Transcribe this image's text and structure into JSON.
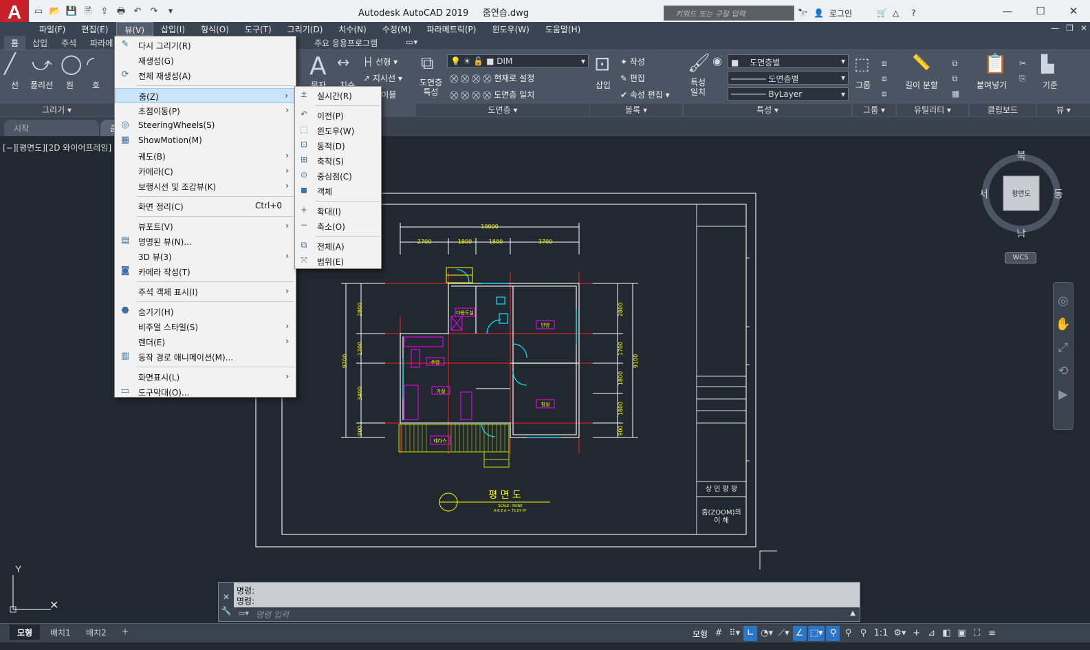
{
  "app": {
    "logo": "A",
    "title": "Autodesk AutoCAD 2019",
    "filename": "줌연습.dwg",
    "search_placeholder": "키워드 또는 구절 입력",
    "login": "로그인"
  },
  "menubar": [
    "파일(F)",
    "편집(E)",
    "뷰(V)",
    "삽입(I)",
    "형식(O)",
    "도구(T)",
    "그리기(D)",
    "치수(N)",
    "수정(M)",
    "파라메트릭(P)",
    "윈도우(W)",
    "도움말(H)"
  ],
  "ribbon_tabs": [
    "홈",
    "삽입",
    "주석",
    "파라메",
    "",
    "",
    "",
    "",
    "주요 응용프로그램"
  ],
  "ribbon": {
    "draw_tools": [
      "선",
      "폴리선",
      "원",
      "호"
    ],
    "draw_panel": "그리기",
    "text": "문자",
    "dim": "치수",
    "linear": "선형",
    "leader": "지시선",
    "table": "테이블",
    "layer_props": "도면층\n특성",
    "layer_current": "DIM",
    "make_current": "현재로 설정",
    "match_layer": "도면층 일치",
    "layer_panel": "도면층",
    "insert": "삽입",
    "create": "작성",
    "edit": "편집",
    "edit_attr": "속성 편집",
    "block_panel": "블록",
    "match_props": "특성\n일치",
    "color_bylayer": "도면층별",
    "linetype_bylayer": "도면층별",
    "lineweight_bylayer": "ByLayer",
    "props_panel": "특성",
    "group": "그룹",
    "group_panel": "그룹",
    "measure": "길이 분할",
    "util_panel": "유틸리티",
    "paste": "붙여넣기",
    "clip_panel": "클립보드",
    "base": "기준",
    "view_panel": "뷰"
  },
  "file_tabs": [
    "시작",
    "줌"
  ],
  "viewport_label": "[−][평면도][2D 와이어프레임]",
  "viewcube": {
    "north": "북",
    "south": "남",
    "east": "동",
    "west": "서",
    "face": "평면도",
    "wcs": "WCS"
  },
  "drawing": {
    "title": "평 면 도",
    "scale": "SCALE : NONE",
    "area": "A R E A = 75.07 M²",
    "dim_total": "10000",
    "dims_top": [
      "2700",
      "1800",
      "1800",
      "3700"
    ],
    "dims_left": [
      "2800",
      "1700",
      "3400",
      "900"
    ],
    "dim_left_total": "9700",
    "dims_right": [
      "2800",
      "1700",
      "1800",
      "1800",
      "900"
    ],
    "dim_right_total": "9100",
    "rooms": [
      "다용도실",
      "안방",
      "주방",
      "거실",
      "침실",
      "테라스"
    ],
    "titleblock_1": "상 민 팡 팡",
    "titleblock_2": "줌(ZOOM)의\n이 해"
  },
  "command": {
    "history": [
      "명령:",
      "명령:"
    ],
    "placeholder": "명령 입력"
  },
  "layout_tabs": [
    "모형",
    "배치1",
    "배치2",
    "+"
  ],
  "status": {
    "model": "모형",
    "scale": "1:1"
  },
  "view_menu": {
    "items": [
      {
        "label": "다시 그리기(R)",
        "icon": "pencil-icon",
        "glyph": "✎",
        "submenu": false
      },
      {
        "label": "재생성(G)",
        "icon": "",
        "glyph": "",
        "submenu": false
      },
      {
        "label": "전체 재생성(A)",
        "icon": "regen-all-icon",
        "glyph": "⟳",
        "submenu": false
      },
      {
        "sep": true
      },
      {
        "label": "줌(Z)",
        "icon": "",
        "glyph": "",
        "submenu": true,
        "highlight": true
      },
      {
        "label": "초점이동(P)",
        "icon": "",
        "glyph": "",
        "submenu": true
      },
      {
        "label": "SteeringWheels(S)",
        "icon": "steering-wheel-icon",
        "glyph": "◎",
        "submenu": false
      },
      {
        "label": "ShowMotion(M)",
        "icon": "showmotion-icon",
        "glyph": "▦",
        "submenu": false
      },
      {
        "label": "궤도(B)",
        "icon": "",
        "glyph": "",
        "submenu": true
      },
      {
        "label": "카메라(C)",
        "icon": "",
        "glyph": "",
        "submenu": true
      },
      {
        "label": "보행시선 및 조감뷰(K)",
        "icon": "",
        "glyph": "",
        "submenu": true
      },
      {
        "sep": true
      },
      {
        "label": "화면 정리(C)",
        "icon": "",
        "glyph": "",
        "submenu": false,
        "shortcut": "Ctrl+0"
      },
      {
        "sep": true
      },
      {
        "label": "뷰포트(V)",
        "icon": "",
        "glyph": "",
        "submenu": true
      },
      {
        "label": "명명된 뷰(N)...",
        "icon": "named-view-icon",
        "glyph": "▤",
        "submenu": false
      },
      {
        "label": "3D 뷰(3)",
        "icon": "",
        "glyph": "",
        "submenu": true
      },
      {
        "label": "카메라 작성(T)",
        "icon": "camera-icon",
        "glyph": "◙",
        "submenu": false
      },
      {
        "sep": true
      },
      {
        "label": "주석 객체 표시(I)",
        "icon": "",
        "glyph": "",
        "submenu": true
      },
      {
        "sep": true
      },
      {
        "label": "숨기기(H)",
        "icon": "hide-icon",
        "glyph": "⬣",
        "submenu": false
      },
      {
        "label": "비주얼 스타일(S)",
        "icon": "",
        "glyph": "",
        "submenu": true
      },
      {
        "label": "렌더(E)",
        "icon": "",
        "glyph": "",
        "submenu": true
      },
      {
        "label": "동작 경로 애니메이션(M)...",
        "icon": "motion-path-icon",
        "glyph": "▥",
        "submenu": false
      },
      {
        "sep": true
      },
      {
        "label": "화면표시(L)",
        "icon": "",
        "glyph": "",
        "submenu": true
      },
      {
        "label": "도구막대(O)...",
        "icon": "toolbar-icon",
        "glyph": "▭",
        "submenu": false
      }
    ]
  },
  "zoom_menu": {
    "items": [
      {
        "label": "실시간(R)",
        "icon": "zoom-realtime-icon",
        "glyph": "±"
      },
      {
        "sep": true
      },
      {
        "label": "이전(P)",
        "icon": "zoom-previous-icon",
        "glyph": "↶"
      },
      {
        "label": "윈도우(W)",
        "icon": "zoom-window-icon",
        "glyph": "⬚"
      },
      {
        "label": "동적(D)",
        "icon": "zoom-dynamic-icon",
        "glyph": "⊡"
      },
      {
        "label": "축척(S)",
        "icon": "zoom-scale-icon",
        "glyph": "⊞"
      },
      {
        "label": "중심점(C)",
        "icon": "zoom-center-icon",
        "glyph": "⊙"
      },
      {
        "label": "객체",
        "icon": "zoom-object-icon",
        "glyph": "◼"
      },
      {
        "sep": true
      },
      {
        "label": "확대(I)",
        "icon": "zoom-in-icon",
        "glyph": "+"
      },
      {
        "label": "축소(O)",
        "icon": "zoom-out-icon",
        "glyph": "−"
      },
      {
        "sep": true
      },
      {
        "label": "전체(A)",
        "icon": "zoom-all-icon",
        "glyph": "⧉"
      },
      {
        "label": "범위(E)",
        "icon": "zoom-extents-icon",
        "glyph": "⤧"
      }
    ]
  },
  "colors": {
    "accent": "#2a75c7",
    "canvas": "#212830",
    "menu_hl": "#cce4f7"
  }
}
